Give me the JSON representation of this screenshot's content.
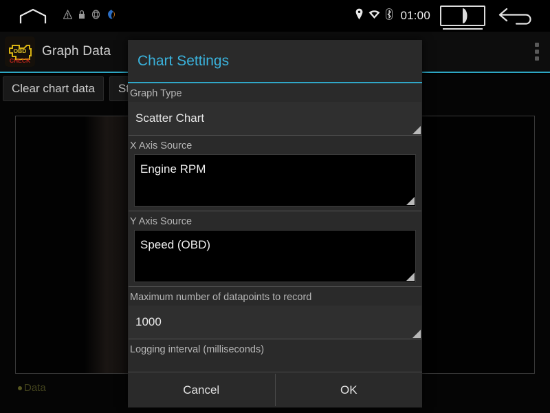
{
  "system_bar": {
    "home_icon": "home-icon",
    "left_icons": [
      "warning-triangle-icon",
      "lock-icon",
      "globe-icon",
      "app-badge-icon"
    ],
    "right_icons": [
      "location-pin-icon",
      "wifi-icon",
      "bluetooth-icon"
    ],
    "time": "01:00",
    "recents_icon": "recents-icon",
    "back_icon": "back-arrow-icon"
  },
  "action_bar": {
    "app_icon": "obd-check-app-icon",
    "app_icon_text_top": "OBD",
    "app_icon_text_bottom": "CHECK",
    "title": "Graph Data",
    "overflow_icon": "overflow-menu-icon",
    "accent_color": "#2da7c4"
  },
  "content": {
    "buttons": [
      {
        "label": "Clear chart data",
        "name": "clear-chart-data-button"
      },
      {
        "label": "Start logging",
        "name": "start-logging-button"
      }
    ],
    "legend": {
      "label": "Data",
      "color": "#55551f"
    }
  },
  "dialog": {
    "title": "Chart Settings",
    "title_color": "#3ab3dd",
    "fields": [
      {
        "label": "Graph Type",
        "type": "spinner",
        "value": "Scatter Chart",
        "name": "graph-type-spinner"
      },
      {
        "label": "X Axis Source",
        "type": "listbox",
        "value": "Engine RPM",
        "name": "x-axis-source-list"
      },
      {
        "label": "Y Axis Source",
        "type": "listbox",
        "value": "Speed (OBD)",
        "name": "y-axis-source-list"
      },
      {
        "label": "Maximum number of datapoints to record",
        "type": "input",
        "value": "1000",
        "name": "max-datapoints-input"
      },
      {
        "label": "Logging interval (milliseconds)",
        "type": "input",
        "value": "",
        "name": "logging-interval-input"
      }
    ],
    "buttons": {
      "cancel": "Cancel",
      "ok": "OK"
    }
  }
}
